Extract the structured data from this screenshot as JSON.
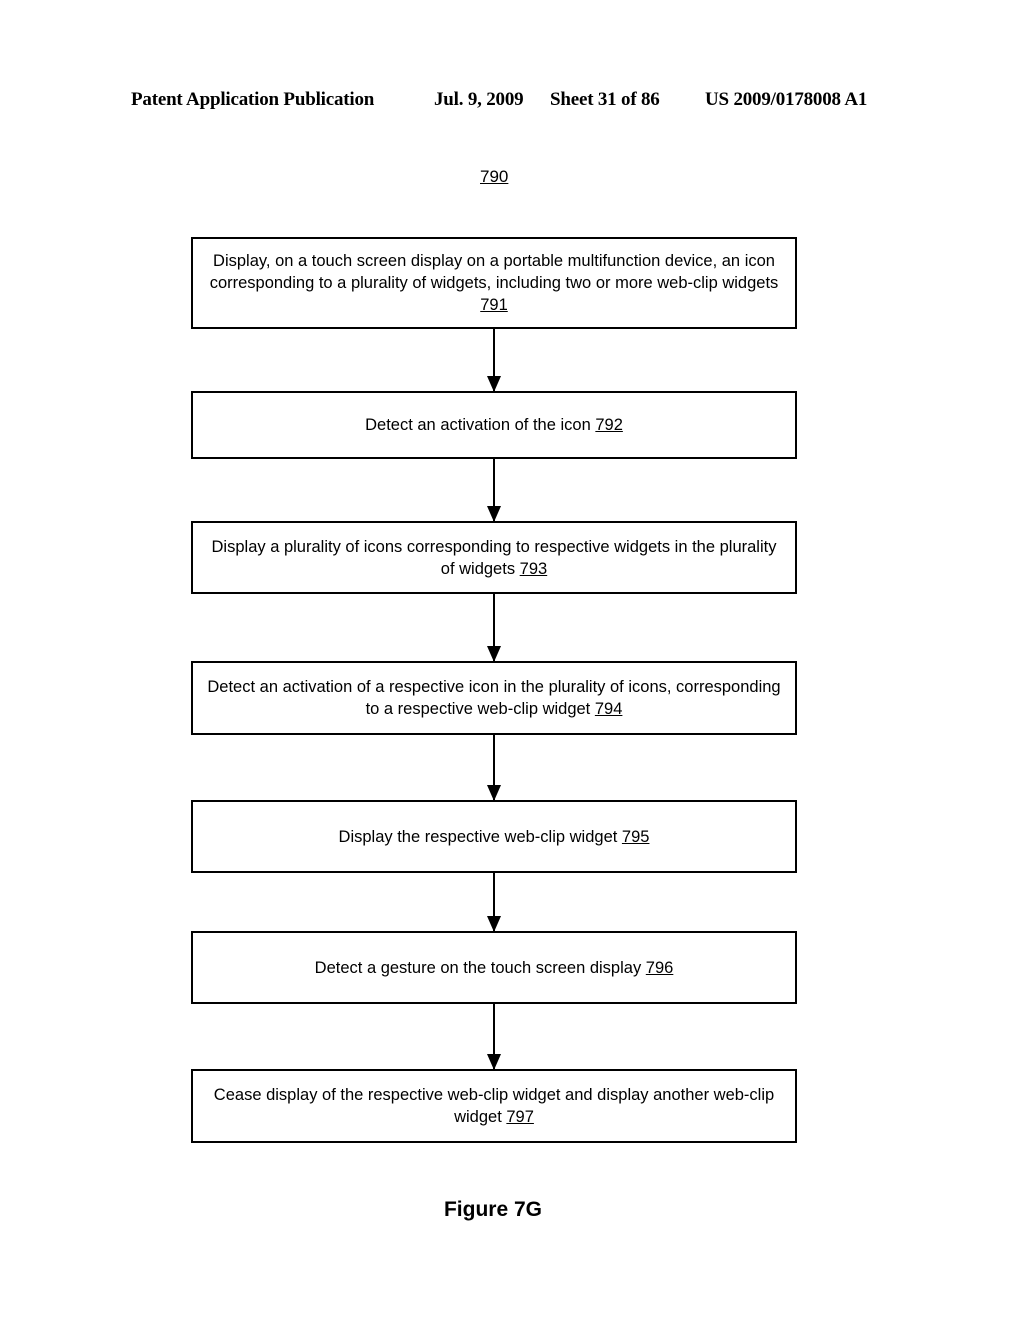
{
  "header": {
    "publication": "Patent Application Publication",
    "date": "Jul. 9, 2009",
    "sheet": "Sheet 31 of 86",
    "patent_number": "US 2009/0178008 A1"
  },
  "diagram": {
    "reference": "790",
    "steps": [
      {
        "text": "Display, on a touch screen display on a portable multifunction device, an icon corresponding to a plurality of widgets, including two or more web-clip widgets",
        "number": "791"
      },
      {
        "text": "Detect an activation of the icon",
        "number": "792"
      },
      {
        "text": "Display a plurality of icons corresponding to respective widgets in the plurality of widgets",
        "number": "793"
      },
      {
        "text": "Detect an activation of a respective icon in the plurality of icons, corresponding to a respective web-clip widget",
        "number": "794"
      },
      {
        "text": "Display the respective web-clip widget",
        "number": "795"
      },
      {
        "text": "Detect a gesture on the touch screen display",
        "number": "796"
      },
      {
        "text": "Cease display of the respective web-clip widget and display another web-clip widget",
        "number": "797"
      }
    ],
    "caption": "Figure 7G"
  }
}
